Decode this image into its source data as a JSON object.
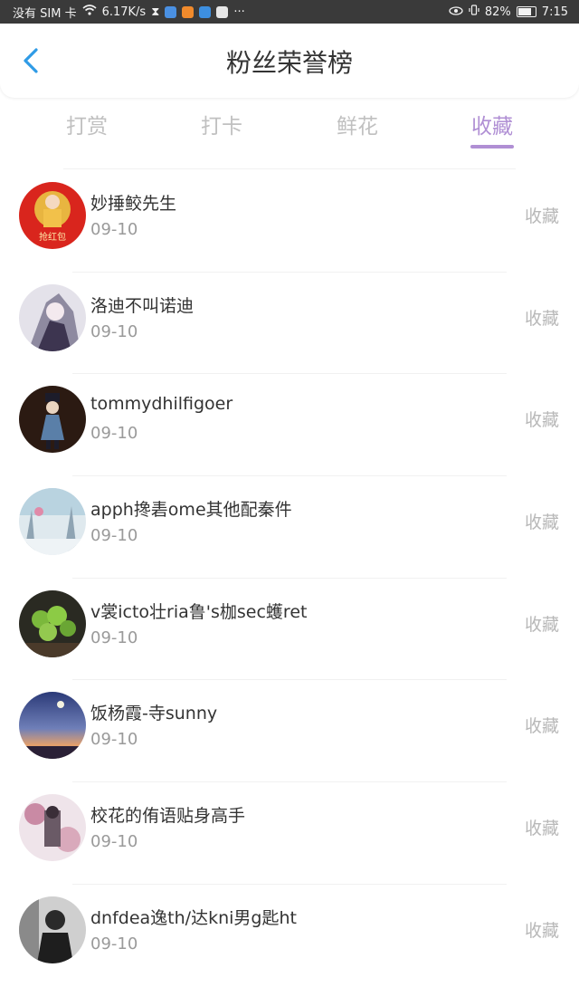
{
  "status_bar": {
    "carrier": "没有 SIM 卡",
    "speed": "6.17K/s",
    "dots": "···",
    "battery": "82%",
    "time": "7:15"
  },
  "header": {
    "title": "粉丝荣誉榜"
  },
  "tabs": [
    {
      "label": "打赏"
    },
    {
      "label": "打卡"
    },
    {
      "label": "鲜花"
    },
    {
      "label": "收藏"
    }
  ],
  "active_tab": "收藏",
  "colors": {
    "accent": "#b08fd4",
    "back_arrow": "#2f9be6"
  },
  "fans": [
    {
      "name": "妙捶鲛先生",
      "date": "09-10",
      "action": "收藏",
      "avatar_label": "抢红包"
    },
    {
      "name": "洛迪不叫诺迪",
      "date": "09-10",
      "action": "收藏"
    },
    {
      "name": "tommydhilfigoer",
      "date": "09-10",
      "action": "收藏"
    },
    {
      "name": "apph搀砉ome其他配秦件",
      "date": "09-10",
      "action": "收藏"
    },
    {
      "name": "v裳icto壮ria鲁's枷sec蠖ret",
      "date": "09-10",
      "action": "收藏"
    },
    {
      "name": "饭杨霞-寺sunny",
      "date": "09-10",
      "action": "收藏"
    },
    {
      "name": "校花的侑语贴身高手",
      "date": "09-10",
      "action": "收藏"
    },
    {
      "name": "dnfdea逸th/达kni男g匙ht",
      "date": "09-10",
      "action": "收藏"
    }
  ]
}
